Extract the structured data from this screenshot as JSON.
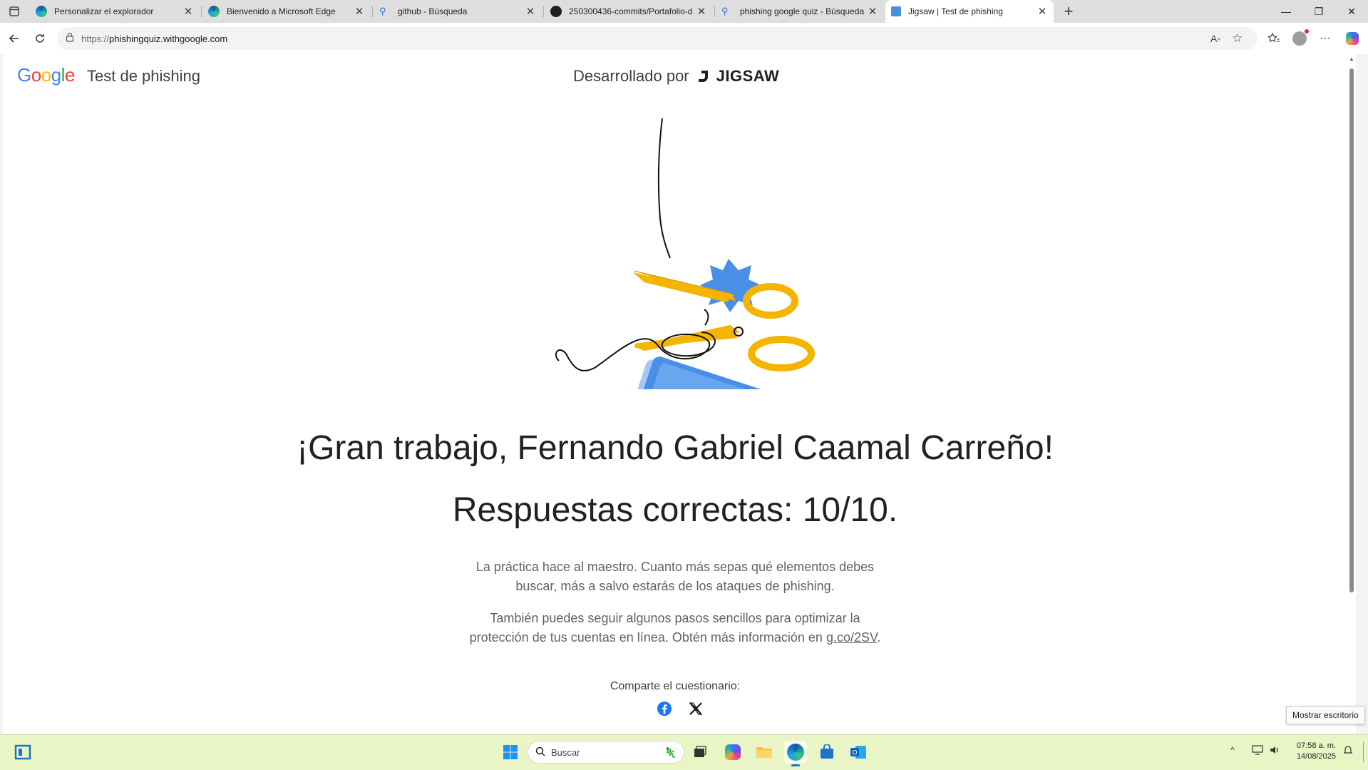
{
  "tabs": [
    {
      "title": "Personalizar el explorador",
      "favicon": "edge-icon"
    },
    {
      "title": "Bienvenido a Microsoft Edge",
      "favicon": "edge-icon"
    },
    {
      "title": "github - Búsqueda",
      "favicon": "search-icon"
    },
    {
      "title": "250300436-commits/Portafolio-d",
      "favicon": "github-icon"
    },
    {
      "title": "phishing google quiz - Búsqueda",
      "favicon": "search-icon"
    },
    {
      "title": "Jigsaw | Test de phishing",
      "favicon": "page-icon",
      "active": true
    }
  ],
  "address_bar": {
    "scheme": "https://",
    "host": "phishingquiz.withgoogle.com"
  },
  "site": {
    "logo": "Google",
    "title": "Test de phishing",
    "developed_by": "Desarrollado por",
    "partner": "JIGSAW"
  },
  "result": {
    "headline": "¡Gran trabajo, Fernando Gabriel Caamal Carreño!",
    "score": "Respuestas correctas: 10/10.",
    "para1_line1": "La práctica hace al maestro. Cuanto más sepas qué elementos debes",
    "para1_line2": "buscar, más a salvo estarás de los ataques de phishing.",
    "para2_line1": "También puedes seguir algunos pasos sencillos para optimizar la",
    "para2_line2_pre": "protección de tus cuentas en línea. Obtén más información en ",
    "para2_link": "g.co/2SV",
    "para2_line2_post": "."
  },
  "share": {
    "label": "Comparte el cuestionario:",
    "buttons": [
      "facebook-icon",
      "x-icon"
    ]
  },
  "tooltip": "Mostrar escritorio",
  "taskbar": {
    "search_placeholder": "Buscar",
    "time": "07:58 a. m.",
    "date": "14/08/2025"
  },
  "colors": {
    "taskbar_bg": "#eaf5c6",
    "scissors": "#f4b400",
    "phone": "#4285f4"
  }
}
